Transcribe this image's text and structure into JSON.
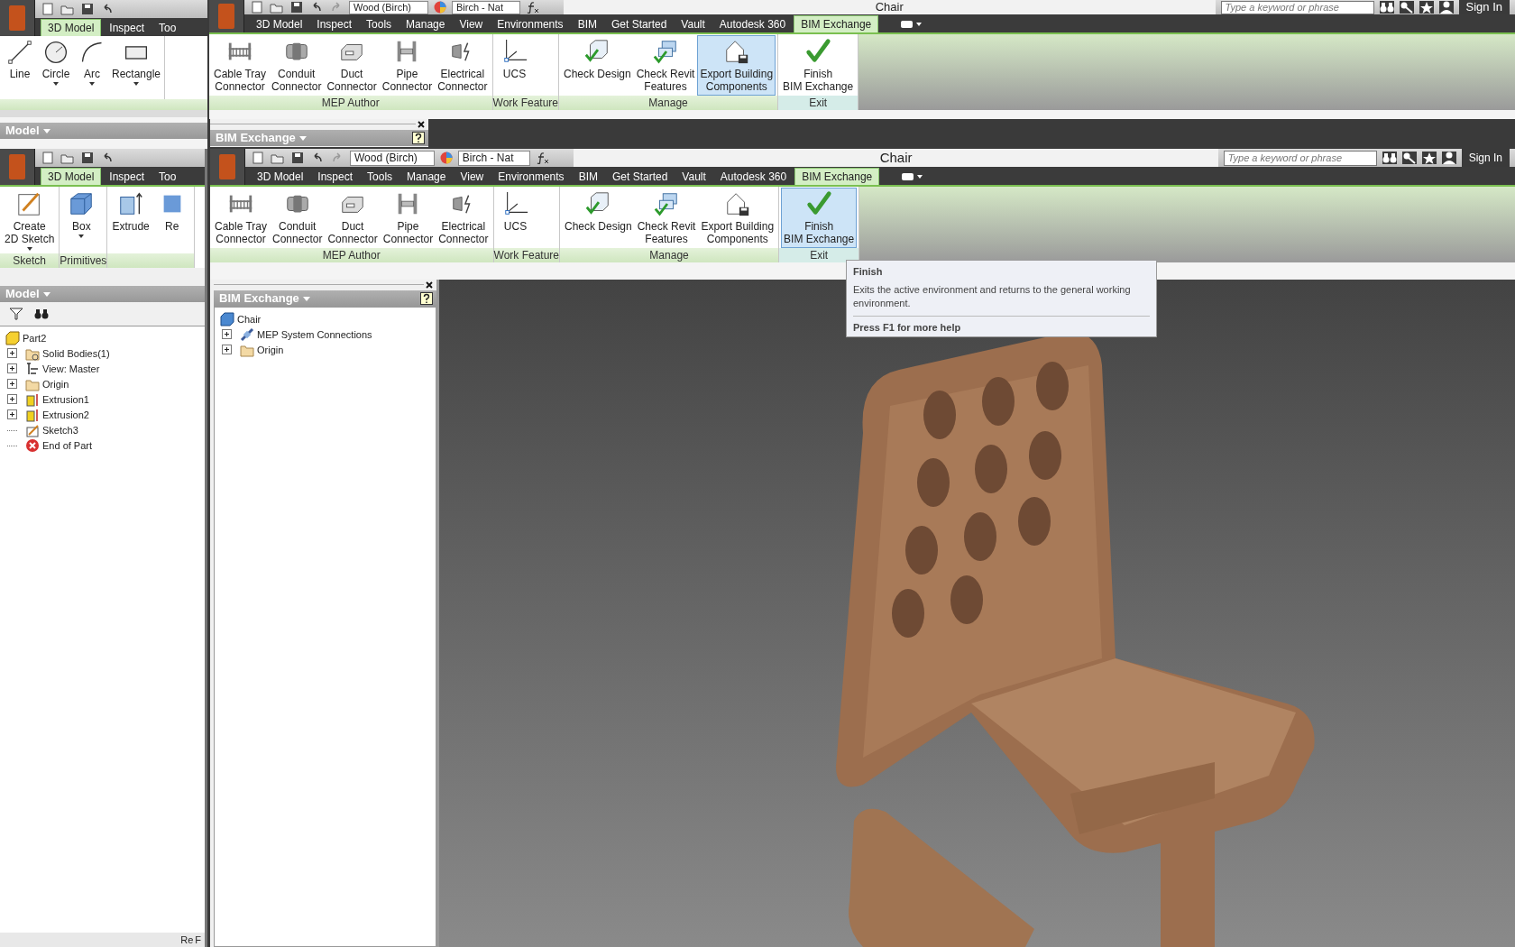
{
  "back_window": {
    "tabs": [
      {
        "label": "3D Model",
        "selected": true
      },
      {
        "label": "Inspect",
        "selected": false
      },
      {
        "label": "Too",
        "selected": false
      }
    ],
    "groups": [
      {
        "tools": [
          {
            "lines": [
              "Line"
            ],
            "menu": false,
            "selected": false
          },
          {
            "lines": [
              "Circle"
            ],
            "menu": true,
            "selected": false
          },
          {
            "lines": [
              "Arc"
            ],
            "menu": true,
            "selected": false
          },
          {
            "lines": [
              "Rectangle"
            ],
            "menu": true,
            "selected": false
          }
        ]
      }
    ],
    "browser_title": "Model"
  },
  "top_window": {
    "material": "Wood (Birch)",
    "appearance": "Birch - Nat",
    "title": "Chair",
    "search": {
      "placeholder": "Type a keyword or phrase"
    },
    "sign_in": "Sign In",
    "tabs": [
      {
        "label": "3D Model",
        "selected": false
      },
      {
        "label": "Inspect",
        "selected": false
      },
      {
        "label": "Tools",
        "selected": false
      },
      {
        "label": "Manage",
        "selected": false
      },
      {
        "label": "View",
        "selected": false
      },
      {
        "label": "Environments",
        "selected": false
      },
      {
        "label": "BIM",
        "selected": false
      },
      {
        "label": "Get Started",
        "selected": false
      },
      {
        "label": "Vault",
        "selected": false
      },
      {
        "label": "Autodesk 360",
        "selected": false
      },
      {
        "label": "BIM Exchange",
        "selected": true
      }
    ],
    "groups": [
      {
        "label": "MEP Author",
        "tools": [
          {
            "lines": [
              "Cable Tray",
              "Connector"
            ],
            "selected": false
          },
          {
            "lines": [
              "Conduit",
              "Connector"
            ],
            "selected": false
          },
          {
            "lines": [
              "Duct",
              "Connector"
            ],
            "selected": false
          },
          {
            "lines": [
              "Pipe",
              "Connector"
            ],
            "selected": false
          },
          {
            "lines": [
              "Electrical",
              "Connector"
            ],
            "selected": false
          }
        ]
      },
      {
        "label": "Work Feature",
        "tools": [
          {
            "lines": [
              "UCS"
            ],
            "selected": false
          }
        ]
      },
      {
        "label": "Manage",
        "tools": [
          {
            "lines": [
              "Check Design"
            ],
            "selected": false
          },
          {
            "lines": [
              "Check Revit",
              "Features"
            ],
            "selected": false
          },
          {
            "lines": [
              "Export Building",
              "Components"
            ],
            "selected": true
          }
        ]
      },
      {
        "label": "Exit",
        "tools": [
          {
            "lines": [
              "Finish",
              "BIM Exchange"
            ],
            "selected": false
          }
        ]
      }
    ],
    "browser_title": "BIM Exchange"
  },
  "left_window": {
    "tabs": [
      {
        "label": "3D Model",
        "selected": true
      },
      {
        "label": "Inspect",
        "selected": false
      },
      {
        "label": "Too",
        "selected": false
      }
    ],
    "groups": [
      {
        "label": "Sketch",
        "tools": [
          {
            "lines": [
              "Create",
              "2D Sketch"
            ],
            "menu": true,
            "selected": false
          }
        ]
      },
      {
        "label": "Primitives",
        "tools": [
          {
            "lines": [
              "Box"
            ],
            "menu": true,
            "selected": false
          }
        ]
      },
      {
        "tools": [
          {
            "lines": [
              "Extrude"
            ],
            "menu": false,
            "selected": false
          },
          {
            "lines": [
              "Re"
            ],
            "menu": false,
            "selected": false
          }
        ]
      }
    ],
    "browser_title": "Model",
    "tree": [
      {
        "label": "Part2",
        "kind": "part",
        "collapsed": false,
        "children": [
          {
            "label": "Solid Bodies(1)",
            "kind": "bodies",
            "collapsed": true
          },
          {
            "label": "View: Master",
            "kind": "view",
            "collapsed": true
          },
          {
            "label": "Origin",
            "kind": "folder",
            "collapsed": true
          },
          {
            "label": "Extrusion1",
            "kind": "extrusion",
            "collapsed": true
          },
          {
            "label": "Extrusion2",
            "kind": "extrusion",
            "collapsed": true
          },
          {
            "label": "Sketch3",
            "kind": "sketch",
            "collapsed": false
          },
          {
            "label": "End of Part",
            "kind": "end",
            "collapsed": false
          }
        ]
      }
    ],
    "status_texts": [
      "Re",
      "F"
    ]
  },
  "main_window": {
    "material": "Wood (Birch)",
    "appearance": "Birch - Nat",
    "title": "Chair",
    "search": {
      "placeholder": "Type a keyword or phrase"
    },
    "sign_in": "Sign In",
    "tabs": [
      {
        "label": "3D Model",
        "selected": false
      },
      {
        "label": "Inspect",
        "selected": false
      },
      {
        "label": "Tools",
        "selected": false
      },
      {
        "label": "Manage",
        "selected": false
      },
      {
        "label": "View",
        "selected": false
      },
      {
        "label": "Environments",
        "selected": false
      },
      {
        "label": "BIM",
        "selected": false
      },
      {
        "label": "Get Started",
        "selected": false
      },
      {
        "label": "Vault",
        "selected": false
      },
      {
        "label": "Autodesk 360",
        "selected": false
      },
      {
        "label": "BIM Exchange",
        "selected": true
      }
    ],
    "groups": [
      {
        "label": "MEP Author",
        "tools": [
          {
            "lines": [
              "Cable Tray",
              "Connector"
            ],
            "selected": false
          },
          {
            "lines": [
              "Conduit",
              "Connector"
            ],
            "selected": false
          },
          {
            "lines": [
              "Duct",
              "Connector"
            ],
            "selected": false
          },
          {
            "lines": [
              "Pipe",
              "Connector"
            ],
            "selected": false
          },
          {
            "lines": [
              "Electrical",
              "Connector"
            ],
            "selected": false
          }
        ]
      },
      {
        "label": "Work Feature",
        "tools": [
          {
            "lines": [
              "UCS"
            ],
            "selected": false
          }
        ]
      },
      {
        "label": "Manage",
        "tools": [
          {
            "lines": [
              "Check Design"
            ],
            "selected": false
          },
          {
            "lines": [
              "Check Revit",
              "Features"
            ],
            "selected": false
          },
          {
            "lines": [
              "Export Building",
              "Components"
            ],
            "selected": false
          }
        ]
      },
      {
        "label": "Exit",
        "tools": [
          {
            "lines": [
              "Finish",
              "BIM Exchange"
            ],
            "selected": true
          }
        ]
      }
    ],
    "browser_title": "BIM Exchange",
    "tree": [
      {
        "label": "Chair",
        "kind": "assembly",
        "collapsed": false,
        "children": [
          {
            "label": "MEP System Connections",
            "kind": "connections",
            "collapsed": true
          },
          {
            "label": "Origin",
            "kind": "folder",
            "collapsed": true
          }
        ]
      }
    ],
    "tooltip": {
      "title": "Finish",
      "body": "Exits the active environment and returns to the general working environment.",
      "footer": "Press F1 for more help"
    }
  }
}
